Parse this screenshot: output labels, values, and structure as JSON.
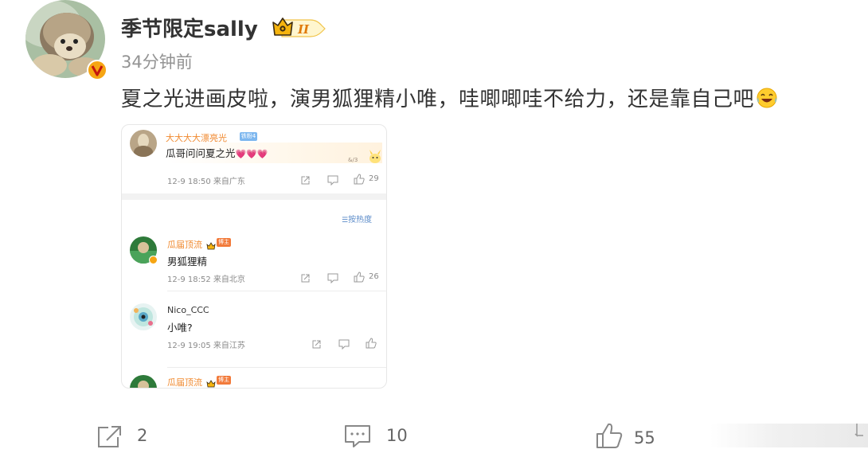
{
  "post": {
    "author": "季节限定sally",
    "vip_level": "II",
    "time": "34分钟前",
    "text": "夏之光进画皮啦，演男狐狸精小唯，哇唧唧哇不给力，还是靠自己吧",
    "text_emoji": "laughing-tears-emoji"
  },
  "screenshot": {
    "top_comment": {
      "author": "大大大大漂亮光",
      "author_tag": "铁粉4",
      "text": "瓜哥问问夏之光",
      "hearts": "💗💗💗",
      "sticker_label": "&/3",
      "meta": "12-9 18:50 来自广东",
      "likes": "29"
    },
    "sort_label": "按热度",
    "replies": [
      {
        "author": "瓜届顶流",
        "tag": "博主",
        "text": "男狐狸精",
        "meta": "12-9 18:52 来自北京",
        "likes": "26"
      },
      {
        "author": "Nico_CCC",
        "text": "小唯?",
        "meta": "12-9 19:05 来自江苏",
        "likes": ""
      },
      {
        "author": "瓜届顶流",
        "tag": "博主"
      }
    ]
  },
  "actions": {
    "repost_count": "2",
    "comment_count": "10",
    "like_count": "55"
  },
  "colors": {
    "accent_orange": "#f08a30",
    "vip_gold": "#f6b40e",
    "muted": "#939393"
  }
}
